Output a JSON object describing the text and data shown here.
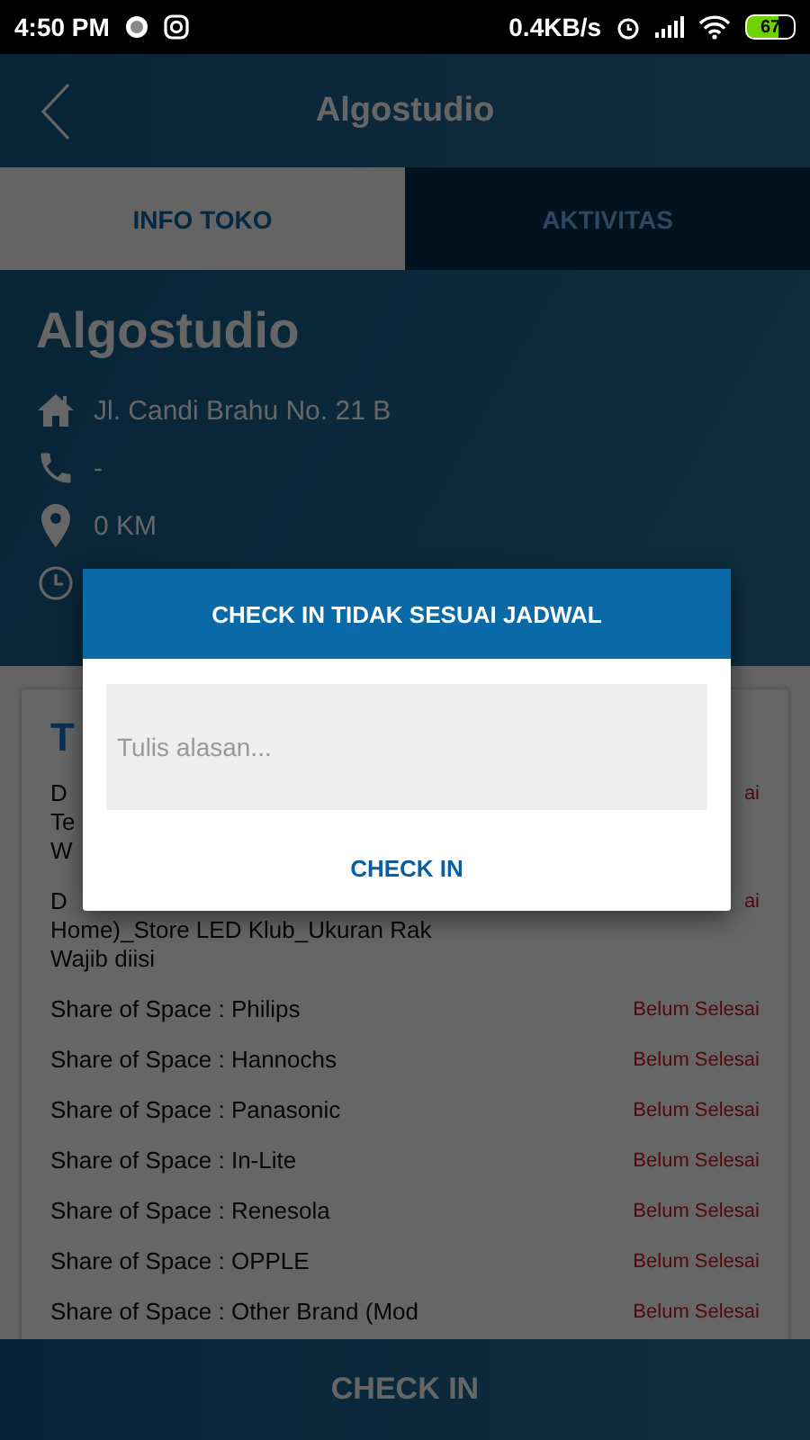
{
  "status_bar": {
    "time": "4:50 PM",
    "speed": "0.4KB/s",
    "battery": "67"
  },
  "header": {
    "title": "Algostudio"
  },
  "tabs": [
    {
      "label": "INFO TOKO",
      "selected": true
    },
    {
      "label": "AKTIVITAS",
      "selected": false
    }
  ],
  "store": {
    "name": "Algostudio",
    "info": [
      {
        "kind": "address",
        "text": "Jl. Candi Brahu No. 21 B"
      },
      {
        "kind": "phone",
        "text": "-"
      },
      {
        "kind": "distance",
        "text": "0 KM"
      },
      {
        "kind": "time"
      }
    ]
  },
  "tasks": {
    "heading": "T",
    "rows": [
      {
        "lines": [
          "D",
          "Te",
          "W"
        ],
        "status": "ai"
      },
      {
        "lines": [
          "D",
          "Home)_Store LED Klub_Ukuran Rak",
          "Wajib diisi"
        ],
        "status": "ai"
      },
      {
        "lines": [
          "Share of Space : Philips"
        ],
        "status": "Belum Selesai"
      },
      {
        "lines": [
          "Share of Space : Hannochs"
        ],
        "status": "Belum Selesai"
      },
      {
        "lines": [
          "Share of Space : Panasonic"
        ],
        "status": "Belum Selesai"
      },
      {
        "lines": [
          "Share of Space : In-Lite"
        ],
        "status": "Belum Selesai"
      },
      {
        "lines": [
          "Share of Space : Renesola"
        ],
        "status": "Belum Selesai"
      },
      {
        "lines": [
          "Share of Space : OPPLE"
        ],
        "status": "Belum Selesai"
      },
      {
        "lines": [
          "Share of Space : Other Brand (Mod"
        ],
        "status": "Belum Selesai"
      }
    ]
  },
  "bottom_button": "CHECK IN",
  "dialog": {
    "title": "CHECK IN TIDAK SESUAI JADWAL",
    "placeholder": "Tulis alasan...",
    "button": "CHECK IN"
  }
}
